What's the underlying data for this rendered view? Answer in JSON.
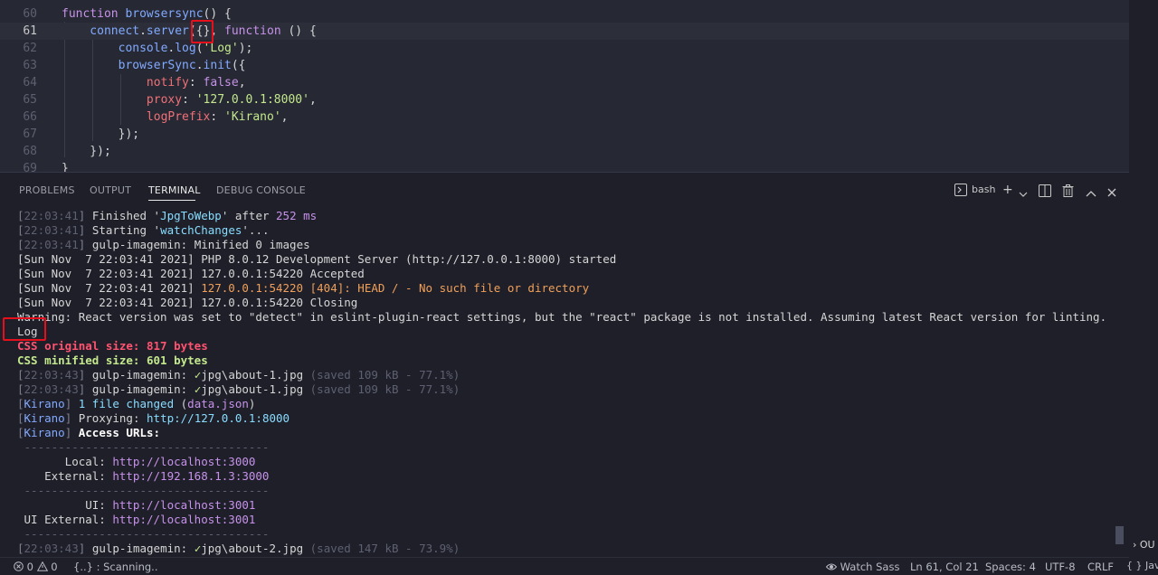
{
  "editor": {
    "lines": [
      {
        "num": "60",
        "parts": [
          [
            "kw",
            "function "
          ],
          [
            "fn",
            "browsersync"
          ],
          [
            "punc",
            "() {"
          ]
        ]
      },
      {
        "num": "61",
        "parts": [
          [
            "fn",
            "    connect"
          ],
          [
            "punc",
            "."
          ],
          [
            "fn",
            "server"
          ],
          [
            "punc",
            "({}, "
          ],
          [
            "kw",
            "function "
          ],
          [
            "punc",
            "() {"
          ]
        ]
      },
      {
        "num": "62",
        "parts": [
          [
            "fn",
            "        console"
          ],
          [
            "punc",
            "."
          ],
          [
            "fn",
            "log"
          ],
          [
            "punc",
            "("
          ],
          [
            "str",
            "'Log'"
          ],
          [
            "punc",
            ");"
          ]
        ]
      },
      {
        "num": "63",
        "parts": [
          [
            "fn",
            "        browserSync"
          ],
          [
            "punc",
            "."
          ],
          [
            "fn",
            "init"
          ],
          [
            "punc",
            "({"
          ]
        ]
      },
      {
        "num": "64",
        "parts": [
          [
            "prop",
            "            notify"
          ],
          [
            "punc",
            ": "
          ],
          [
            "kw",
            "false"
          ],
          [
            "punc",
            ","
          ]
        ]
      },
      {
        "num": "65",
        "parts": [
          [
            "prop",
            "            proxy"
          ],
          [
            "punc",
            ": "
          ],
          [
            "str",
            "'127.0.0.1:8000'"
          ],
          [
            "punc",
            ","
          ]
        ]
      },
      {
        "num": "66",
        "parts": [
          [
            "prop",
            "            logPrefix"
          ],
          [
            "punc",
            ": "
          ],
          [
            "str",
            "'Kirano'"
          ],
          [
            "punc",
            ","
          ]
        ]
      },
      {
        "num": "67",
        "parts": [
          [
            "punc",
            "        });"
          ]
        ]
      },
      {
        "num": "68",
        "parts": [
          [
            "punc",
            "    });"
          ]
        ]
      },
      {
        "num": "69",
        "parts": [
          [
            "punc",
            "}"
          ]
        ]
      }
    ]
  },
  "panel": {
    "tabs": [
      "PROBLEMS",
      "OUTPUT",
      "TERMINAL",
      "DEBUG CONSOLE"
    ],
    "active_tab": "TERMINAL",
    "shell": "bash"
  },
  "terminal": [
    [
      [
        "ts",
        "["
      ],
      [
        "dim",
        "22:03:41"
      ],
      [
        "ts",
        "] "
      ],
      [
        "",
        "Finished '"
      ],
      [
        "cy",
        "JpgToWebp"
      ],
      [
        "",
        "' after "
      ],
      [
        "mg",
        "252 ms"
      ]
    ],
    [
      [
        "ts",
        "["
      ],
      [
        "dim",
        "22:03:41"
      ],
      [
        "ts",
        "] "
      ],
      [
        "",
        "Starting '"
      ],
      [
        "cy",
        "watchChanges"
      ],
      [
        "",
        "'..."
      ]
    ],
    [
      [
        "ts",
        "["
      ],
      [
        "dim",
        "22:03:41"
      ],
      [
        "ts",
        "] "
      ],
      [
        "",
        "gulp-imagemin: Minified 0 images"
      ]
    ],
    [
      [
        "",
        "[Sun Nov  7 22:03:41 2021] PHP 8.0.12 Development Server (http://127.0.0.1:8000) started"
      ]
    ],
    [
      [
        "",
        "[Sun Nov  7 22:03:41 2021] 127.0.0.1:54220 Accepted"
      ]
    ],
    [
      [
        "",
        "[Sun Nov  7 22:03:41 2021] "
      ],
      [
        "or",
        "127.0.0.1:54220 [404]: HEAD / - No such file or directory"
      ]
    ],
    [
      [
        "",
        "[Sun Nov  7 22:03:41 2021] 127.0.0.1:54220 Closing"
      ]
    ],
    [
      [
        "",
        "Warning: React version was set to \"detect\" in eslint-plugin-react settings, but the \"react\" package is not installed. Assuming latest React version for linting."
      ]
    ],
    [
      [
        "",
        "Log"
      ]
    ],
    [
      [
        "red",
        "CSS original size: 817 bytes"
      ]
    ],
    [
      [
        "grn",
        "CSS minified size: 601 bytes"
      ]
    ],
    [
      [
        "ts",
        "["
      ],
      [
        "dim",
        "22:03:43"
      ],
      [
        "ts",
        "] "
      ],
      [
        "",
        "gulp-imagemin: "
      ],
      [
        "chk",
        "✓"
      ],
      [
        "",
        "jpg\\about-1.jpg "
      ],
      [
        "dim",
        "(saved 109 kB - 77.1%)"
      ]
    ],
    [
      [
        "ts",
        "["
      ],
      [
        "dim",
        "22:03:43"
      ],
      [
        "ts",
        "] "
      ],
      [
        "",
        "gulp-imagemin: "
      ],
      [
        "chk",
        "✓"
      ],
      [
        "",
        "jpg\\about-1.jpg "
      ],
      [
        "dim",
        "(saved 109 kB - 77.1%)"
      ]
    ],
    [
      [
        "ts",
        "["
      ],
      [
        "bl",
        "Kirano"
      ],
      [
        "ts",
        "] "
      ],
      [
        "cy",
        "1 file changed "
      ],
      [
        "",
        "("
      ],
      [
        "mg",
        "data.json"
      ],
      [
        "",
        ")"
      ]
    ],
    [
      [
        "ts",
        "["
      ],
      [
        "bl",
        "Kirano"
      ],
      [
        "ts",
        "] "
      ],
      [
        "",
        "Proxying: "
      ],
      [
        "cy",
        "http://127.0.0.1:8000"
      ]
    ],
    [
      [
        "ts",
        "["
      ],
      [
        "bl",
        "Kirano"
      ],
      [
        "ts",
        "] "
      ],
      [
        "wb",
        "Access URLs:"
      ]
    ],
    [
      [
        "dim",
        " ------------------------------------"
      ]
    ],
    [
      [
        "",
        "       Local: "
      ],
      [
        "mg",
        "http://localhost:3000"
      ]
    ],
    [
      [
        "",
        "    External: "
      ],
      [
        "mg",
        "http://192.168.1.3:3000"
      ]
    ],
    [
      [
        "dim",
        " ------------------------------------"
      ]
    ],
    [
      [
        "",
        "          UI: "
      ],
      [
        "mg",
        "http://localhost:3001"
      ]
    ],
    [
      [
        "",
        "",
        " UI External: "
      ],
      [
        "mg",
        "http://localhost:3001"
      ]
    ],
    [
      [
        "dim",
        " ------------------------------------"
      ]
    ],
    [
      [
        "ts",
        "["
      ],
      [
        "dim",
        "22:03:43"
      ],
      [
        "ts",
        "] "
      ],
      [
        "",
        "gulp-imagemin: "
      ],
      [
        "chk",
        "✓"
      ],
      [
        "",
        "jpg\\about-2.jpg "
      ],
      [
        "dim",
        "(saved 147 kB - 73.9%)"
      ]
    ]
  ],
  "status": {
    "errors": "0",
    "warnings": "0",
    "scanning": "{..} : Scanning..",
    "watch_sass": "Watch Sass",
    "position": "Ln 61, Col 21",
    "spaces": "Spaces: 4",
    "encoding": "UTF-8",
    "eol": "CRLF",
    "language": "{ } Jav",
    "side_peek": "› OU"
  },
  "colors": {
    "background": "#1e1f29",
    "editor_bg": "#262833",
    "highlight_box": "#e5101b"
  }
}
